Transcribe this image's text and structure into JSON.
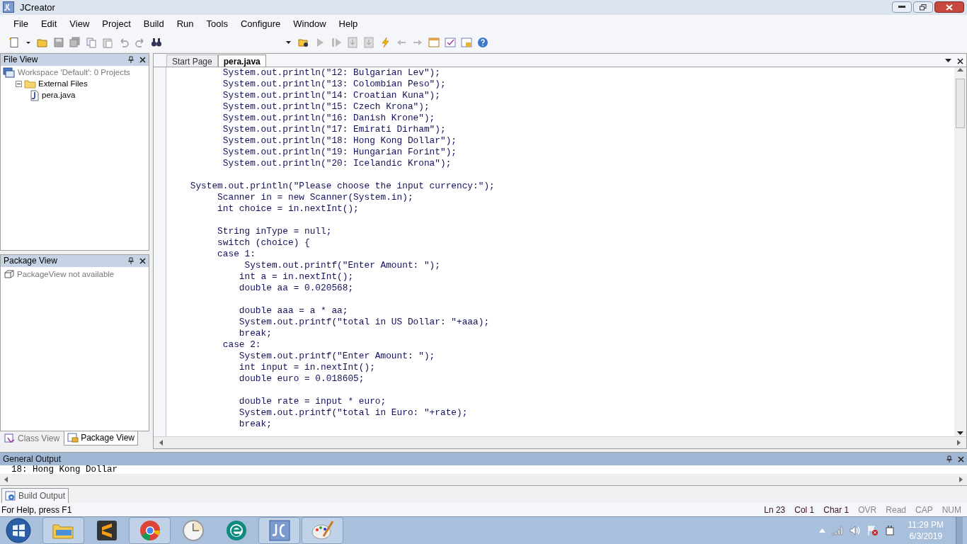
{
  "window": {
    "title": "JCreator"
  },
  "menu": [
    "File",
    "Edit",
    "View",
    "Project",
    "Build",
    "Run",
    "Tools",
    "Configure",
    "Window",
    "Help"
  ],
  "file_view": {
    "title": "File View",
    "tree": [
      {
        "label": "Workspace 'Default': 0 Projects",
        "disabled": true,
        "children": [
          {
            "label": "External Files",
            "disabled": false,
            "expanded": true,
            "children": [
              {
                "label": "pera.java",
                "disabled": false
              }
            ]
          }
        ]
      }
    ]
  },
  "package_view": {
    "title": "Package View",
    "message": "PackageView not available"
  },
  "side_tabs": [
    {
      "label": "Class View",
      "selected": false
    },
    {
      "label": "Package View",
      "selected": true
    }
  ],
  "editor_tabs": [
    {
      "label": "Start Page",
      "selected": false
    },
    {
      "label": "pera.java",
      "selected": true
    }
  ],
  "code": [
    {
      "text": "          System.out.println(\"12: Bulgarian Lev\");"
    },
    {
      "text": "          System.out.println(\"13: Colombian Peso\");"
    },
    {
      "text": "          System.out.println(\"14: Croatian Kuna\");"
    },
    {
      "text": "          System.out.println(\"15: Czech Krona\");"
    },
    {
      "text": "          System.out.println(\"16: Danish Krone\");"
    },
    {
      "text": "          System.out.println(\"17: Emirati Dirham\");"
    },
    {
      "text": "          System.out.println(\"18: Hong Kong Dollar\");"
    },
    {
      "text": "          System.out.println(\"19: Hungarian Forint\");"
    },
    {
      "text": "          System.out.println(\"20: Icelandic Krona\");"
    },
    {
      "text": "    System.out.println(\"Please choose the input currency:\");",
      "blank_before": true
    },
    {
      "text": "         Scanner in = new Scanner(System.in);"
    },
    {
      "text": "         int choice = in.nextInt();"
    },
    {
      "text": "         String inType = null;",
      "blank_before": true
    },
    {
      "text": "         switch (choice) {"
    },
    {
      "text": "         case 1:"
    },
    {
      "text": "              System.out.printf(\"Enter Amount: \");"
    },
    {
      "text": "             int a = in.nextInt();"
    },
    {
      "text": "             double aa = 0.020568;"
    },
    {
      "text": "             double aaa = a * aa;",
      "blank_before": true
    },
    {
      "text": "             System.out.printf(\"total in US Dollar: \"+aaa);"
    },
    {
      "text": "             break;"
    },
    {
      "text": "          case 2:"
    },
    {
      "text": "             System.out.printf(\"Enter Amount: \");"
    },
    {
      "text": "             int input = in.nextInt();"
    },
    {
      "text": "             double euro = 0.018605;"
    },
    {
      "text": "             double rate = input * euro;",
      "blank_before": true
    },
    {
      "text": "             System.out.printf(\"total in Euro: \"+rate);"
    },
    {
      "text": "             break;"
    }
  ],
  "output": {
    "title": "General Output",
    "lines": [
      "18: Hong Kong Dollar"
    ]
  },
  "output_tabs": [
    {
      "label": "Build Output",
      "selected": true
    }
  ],
  "status_bar": {
    "help": "For Help, press F1",
    "indicators": [
      {
        "label": "Ln 23",
        "disabled": false
      },
      {
        "label": "Col 1",
        "disabled": false
      },
      {
        "label": "Char 1",
        "disabled": false
      },
      {
        "label": "OVR",
        "disabled": true
      },
      {
        "label": "Read",
        "disabled": true
      },
      {
        "label": "CAP",
        "disabled": true
      },
      {
        "label": "NUM",
        "disabled": true
      }
    ]
  },
  "taskbar": {
    "time": "11:29 PM",
    "date": "6/3/2019"
  }
}
